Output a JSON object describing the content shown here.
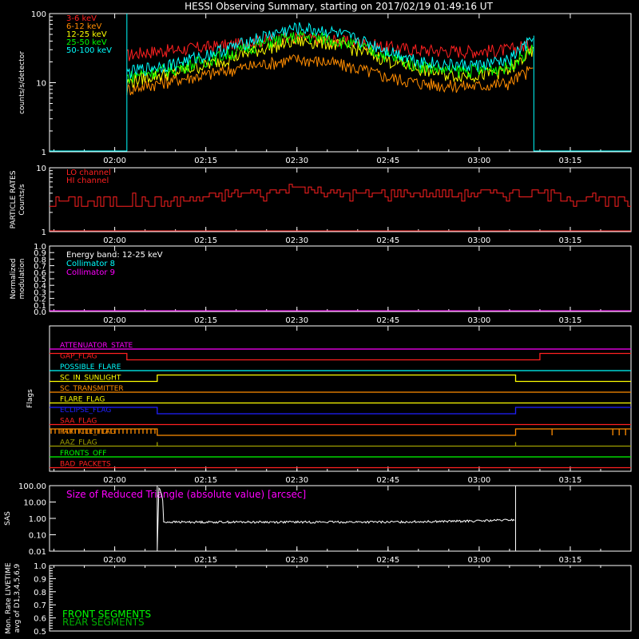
{
  "title": "HESSI Observing Summary, starting on 2017/02/19 01:49:16 UT",
  "colors": {
    "bg": "#000000",
    "axis": "#ffffff",
    "red": "#ff2020",
    "orange": "#ff8c00",
    "yellow": "#ffff00",
    "green": "#00ff00",
    "cyan": "#00ffff",
    "magenta": "#ff00ff",
    "blue": "#2020ff",
    "olive": "#a0a000",
    "darkgreen": "#00b000"
  },
  "time_ticks": [
    "02:00",
    "02:15",
    "02:30",
    "02:45",
    "03:00",
    "03:15"
  ],
  "chart_data": [
    {
      "type": "line",
      "panel": "light_curves",
      "ylabel": "counts/s/detector",
      "yscale": "log",
      "ylim": [
        1,
        100
      ],
      "ytick_labels": [
        "1",
        "10",
        "100"
      ],
      "xlim": [
        "01:49:16",
        "03:25:00"
      ],
      "x": [
        "02:02",
        "02:05",
        "02:10",
        "02:15",
        "02:20",
        "02:25",
        "02:30",
        "02:35",
        "02:40",
        "02:45",
        "02:50",
        "02:55",
        "03:00",
        "03:05",
        "03:09"
      ],
      "series": [
        {
          "name": "3-6 keV",
          "color": "red",
          "values": [
            25,
            28,
            30,
            33,
            36,
            42,
            45,
            42,
            38,
            33,
            30,
            29,
            29,
            30,
            38
          ]
        },
        {
          "name": "6-12 keV",
          "color": "orange",
          "values": [
            8,
            9,
            11,
            13,
            16,
            19,
            22,
            20,
            16,
            12,
            10,
            9,
            9,
            10,
            16
          ]
        },
        {
          "name": "12-25 keV",
          "color": "yellow",
          "values": [
            10,
            12,
            14,
            18,
            24,
            32,
            40,
            38,
            30,
            21,
            16,
            13,
            13,
            15,
            28
          ]
        },
        {
          "name": "25-50 keV",
          "color": "green",
          "values": [
            12,
            14,
            16,
            21,
            28,
            38,
            47,
            44,
            34,
            24,
            18,
            15,
            15,
            17,
            32
          ]
        },
        {
          "name": "50-100 keV",
          "color": "cyan",
          "values": [
            14,
            16,
            19,
            25,
            34,
            48,
            62,
            56,
            42,
            29,
            21,
            18,
            18,
            21,
            42
          ]
        }
      ]
    },
    {
      "type": "line",
      "panel": "particle_rates",
      "ylabel": "PARTICLE RATES Counts/s",
      "yscale": "log",
      "ylim": [
        1,
        10
      ],
      "ytick_labels": [
        "1",
        "10"
      ],
      "x": [
        "02:02",
        "02:10",
        "02:20",
        "02:25",
        "02:30",
        "02:35",
        "02:40",
        "02:50",
        "03:00",
        "03:10",
        "03:20"
      ],
      "series": [
        {
          "name": "LO channel",
          "color": "red",
          "values": [
            3,
            3,
            4,
            4,
            5,
            4,
            4,
            4,
            4,
            4,
            3
          ]
        },
        {
          "name": "HI channel",
          "color": "red",
          "values": [
            1,
            1,
            1,
            1,
            1,
            1,
            1,
            1,
            1,
            1,
            1
          ]
        }
      ]
    },
    {
      "type": "line",
      "panel": "modulation",
      "ylabel": "Normalized modulation",
      "ylim": [
        0,
        1
      ],
      "ytick_labels": [
        "0.0",
        "0.1",
        "0.2",
        "0.3",
        "0.4",
        "0.5",
        "0.6",
        "0.7",
        "0.8",
        "0.9",
        "1.0"
      ],
      "annotation": "Energy band: 12-25 keV",
      "series": [
        {
          "name": "Collimator 8",
          "color": "cyan",
          "values": [
            0,
            0
          ]
        },
        {
          "name": "Collimator 9",
          "color": "magenta",
          "values": [
            0,
            0
          ]
        }
      ]
    },
    {
      "type": "line",
      "panel": "flags",
      "ylabel": "Flags",
      "series": [
        {
          "name": "ATTENUATOR_STATE",
          "color": "magenta",
          "values": [
            0
          ]
        },
        {
          "name": "GAP_FLAG",
          "color": "red",
          "values": [
            1,
            0,
            1
          ]
        },
        {
          "name": "POSSIBLE_FLARE",
          "color": "cyan",
          "values": [
            0
          ]
        },
        {
          "name": "SC_IN_SUNLIGHT",
          "color": "yellow",
          "values": [
            0,
            1,
            0
          ]
        },
        {
          "name": "SC_TRANSMITTER",
          "color": "orange",
          "values": [
            0
          ]
        },
        {
          "name": "FLARE_FLAG",
          "color": "yellow",
          "values": [
            0
          ]
        },
        {
          "name": "ECLIPSE_FLAG",
          "color": "blue",
          "values": [
            1,
            0,
            1
          ]
        },
        {
          "name": "SAA_FLAG",
          "color": "red",
          "values": [
            0
          ]
        },
        {
          "name": "PARTICLE_FLAG",
          "color": "orange",
          "values": [
            1,
            0,
            1
          ]
        },
        {
          "name": "AAZ_FLAG",
          "color": "olive",
          "values": [
            0
          ]
        },
        {
          "name": "FRONTS_OFF",
          "color": "green",
          "values": [
            0
          ]
        },
        {
          "name": "BAD_PACKETS",
          "color": "red",
          "values": [
            0
          ]
        }
      ]
    },
    {
      "type": "line",
      "panel": "sas",
      "ylabel": "SAS",
      "yscale": "log",
      "ylim": [
        0.01,
        100
      ],
      "ytick_labels": [
        "0.01",
        "0.10",
        "1.00",
        "10.00",
        "100.00"
      ],
      "annotation": "Size of Reduced Triangle (absolute value) [arcsec]",
      "x": [
        "02:07",
        "02:08",
        "02:15",
        "02:30",
        "02:45",
        "03:00",
        "03:05"
      ],
      "series": [
        {
          "name": "",
          "color": "axis",
          "values": [
            100,
            0.6,
            0.6,
            0.6,
            0.6,
            0.7,
            0.8
          ]
        }
      ]
    },
    {
      "type": "line",
      "panel": "livetime",
      "ylabel": "Mon. Rate LIVETIME avg of D1,3,4,5,6,9",
      "ylim": [
        0.5,
        1.0
      ],
      "ytick_labels": [
        "0.5",
        "0.6",
        "0.7",
        "0.8",
        "0.9",
        "1.0"
      ],
      "series": [
        {
          "name": "FRONT SEGMENTS",
          "color": "green",
          "values": []
        },
        {
          "name": "REAR SEGMENTS",
          "color": "darkgreen",
          "values": []
        }
      ]
    }
  ]
}
